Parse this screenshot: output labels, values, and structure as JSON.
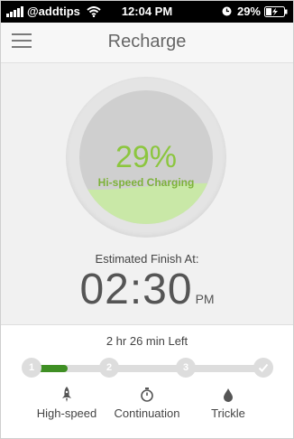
{
  "status_bar": {
    "carrier": "@addtips",
    "time": "12:04 PM",
    "battery_percent": "29%",
    "icons": [
      "signal-icon",
      "wifi-icon",
      "clock-icon",
      "battery-charging-icon"
    ]
  },
  "header": {
    "title": "Recharge",
    "menu_icon": "hamburger-menu-icon"
  },
  "gauge": {
    "percent_text": "29%",
    "charge_level": 0.29,
    "mode_label": "Hi-speed Charging",
    "fill_color": "#c9e8a7",
    "text_color": "#8cc63f"
  },
  "finish": {
    "label": "Estimated Finish At:",
    "time": "02:30",
    "ampm": "PM"
  },
  "progress": {
    "time_left": "2 hr 26 min Left",
    "active_color": "#3f8f24",
    "steps": [
      {
        "number": "1",
        "state": "active"
      },
      {
        "number": "2",
        "state": "pending"
      },
      {
        "number": "3",
        "state": "pending"
      },
      {
        "number": "",
        "state": "pending",
        "icon": "checkmark-icon"
      }
    ]
  },
  "modes": [
    {
      "label": "High-speed",
      "icon": "rocket-icon"
    },
    {
      "label": "Continuation",
      "icon": "stopwatch-icon"
    },
    {
      "label": "Trickle",
      "icon": "water-drop-icon"
    }
  ]
}
